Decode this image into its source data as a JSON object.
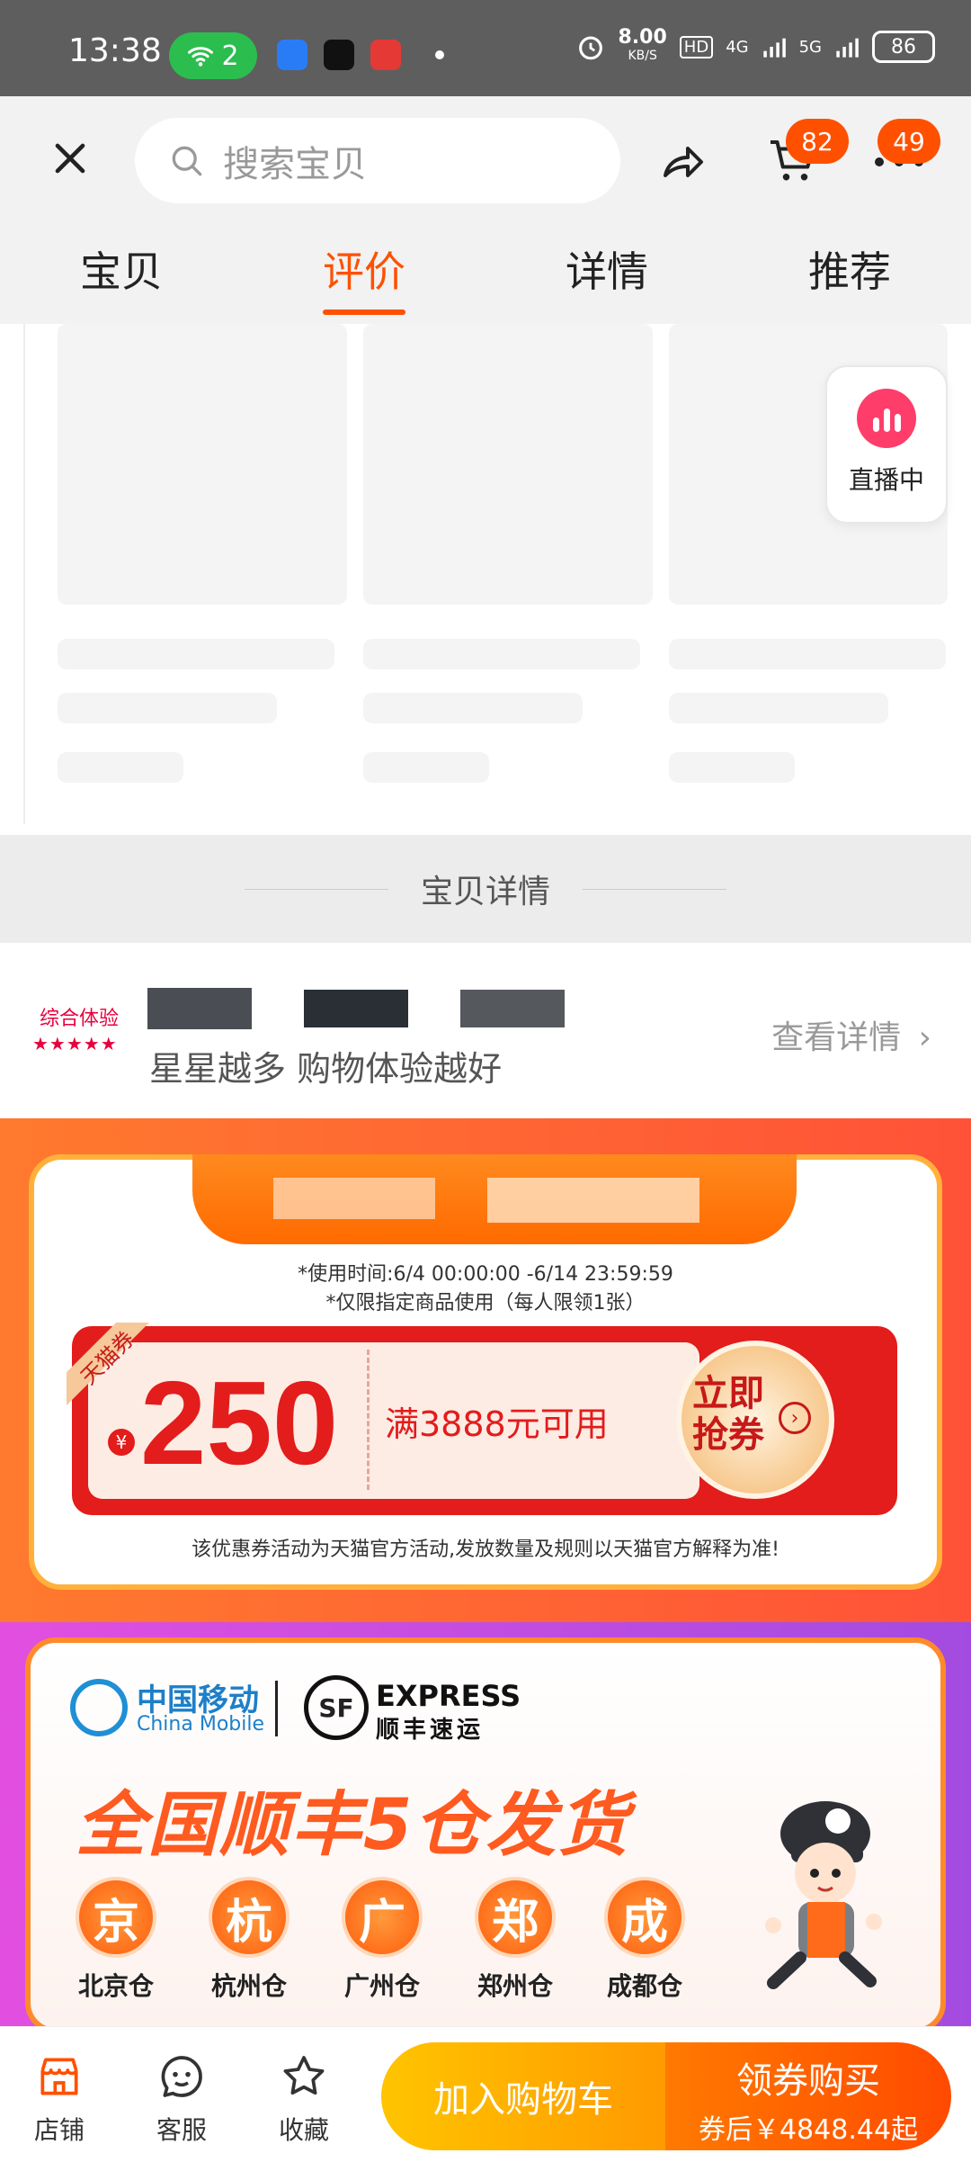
{
  "status_bar": {
    "time": "13:38",
    "wifi_count": "2",
    "net_speed_value": "8.00",
    "net_speed_unit": "KB/S",
    "hd_label": "HD",
    "network_4g": "4G",
    "network_5g": "5G",
    "battery": "86"
  },
  "header": {
    "search_placeholder": "搜索宝贝",
    "cart_badge": "82",
    "more_badge": "49"
  },
  "tabs": [
    {
      "label": "宝贝",
      "active": false
    },
    {
      "label": "评价",
      "active": true
    },
    {
      "label": "详情",
      "active": false
    },
    {
      "label": "推荐",
      "active": false
    }
  ],
  "live_badge": {
    "label": "直播中"
  },
  "section_divider": {
    "label": "宝贝详情"
  },
  "rating": {
    "label": "综合体验",
    "stars": "★★★★★",
    "slogan": "星星越多 购物体验越好",
    "view_detail": "查看详情"
  },
  "coupon": {
    "time_range": "*使用时间:6/4 00:00:00 -6/14 23:59:59",
    "limit_note": "*仅限指定商品使用（每人限领1张）",
    "corner_tag": "天猫券",
    "currency": "¥",
    "amount": "250",
    "threshold": "满3888元可用",
    "grab_label": "立即抢券",
    "footnote": "该优惠券活动为天猫官方活动,发放数量及规则以天猫官方解释为准!"
  },
  "shipping": {
    "china_mobile_cn": "中国移动",
    "china_mobile_en": "China Mobile",
    "sf_express_en": "EXPRESS",
    "sf_express_cn": "顺丰速运",
    "headline": "全国顺丰5仓发货",
    "warehouses": [
      {
        "char": "京",
        "label": "北京仓"
      },
      {
        "char": "杭",
        "label": "杭州仓"
      },
      {
        "char": "广",
        "label": "广州仓"
      },
      {
        "char": "郑",
        "label": "郑州仓"
      },
      {
        "char": "成",
        "label": "成都仓"
      }
    ]
  },
  "bottom_bar": {
    "store_label": "店铺",
    "service_label": "客服",
    "favorite_label": "收藏",
    "add_cart_label": "加入购物车",
    "buy_label": "领券购买",
    "buy_sub": "券后￥4848.44起"
  },
  "colors": {
    "accent": "#ff5000",
    "tmall_red": "#e31c1c"
  }
}
